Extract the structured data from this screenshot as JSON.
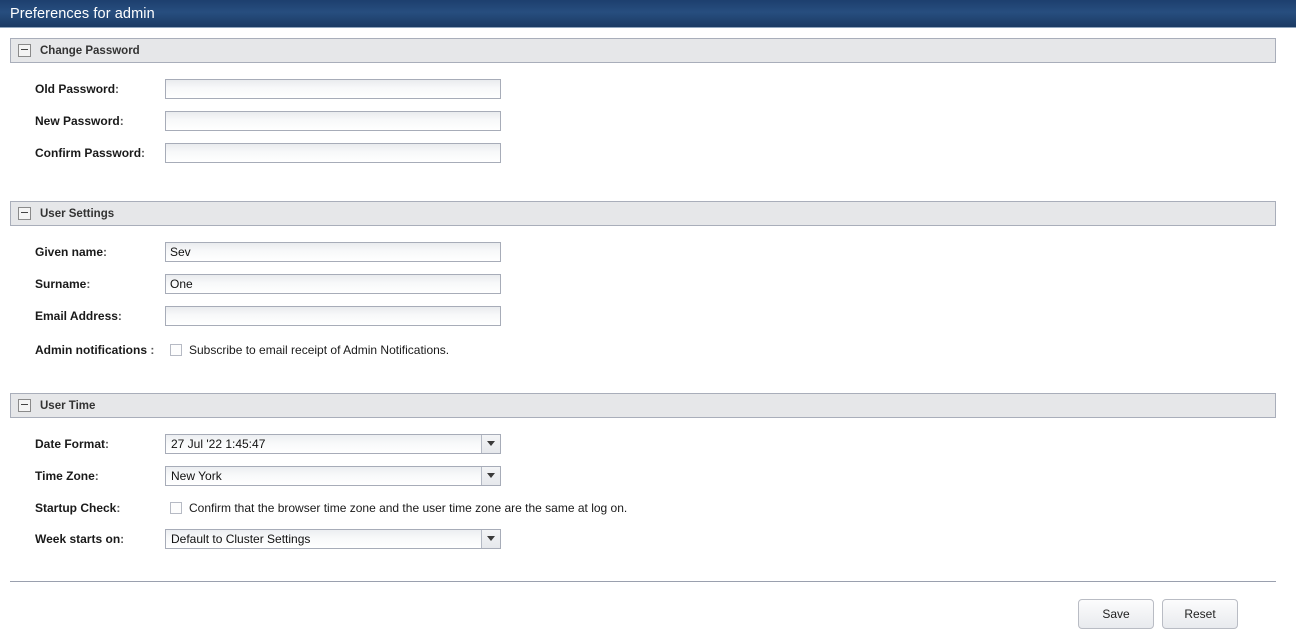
{
  "titlebar": {
    "title": "Preferences for admin"
  },
  "sections": [
    {
      "id": "change-password",
      "title": "Change Password",
      "collapse_icon": "minus-box-icon"
    },
    {
      "id": "user-settings",
      "title": "User Settings",
      "collapse_icon": "minus-box-icon"
    },
    {
      "id": "user-time",
      "title": "User Time",
      "collapse_icon": "minus-box-icon"
    }
  ],
  "change_password": {
    "old_password": {
      "label": "Old Password",
      "colon": ":",
      "value": ""
    },
    "new_password": {
      "label": "New Password",
      "colon": ":",
      "value": ""
    },
    "confirm_password": {
      "label": "Confirm Password",
      "colon": ":",
      "value": ""
    }
  },
  "user_settings": {
    "given_name": {
      "label": "Given name",
      "colon": ":",
      "value": "Sev"
    },
    "surname": {
      "label": "Surname",
      "colon": ":",
      "value": "One"
    },
    "email_address": {
      "label": "Email Address",
      "colon": ":",
      "value": ""
    },
    "admin_notifications": {
      "label": "Admin notifications ",
      "colon": ":",
      "checkbox_label": "Subscribe to email receipt of Admin Notifications.",
      "checked": false
    }
  },
  "user_time": {
    "date_format": {
      "label": "Date Format",
      "colon": ":",
      "value": "27 Jul '22 1:45:47",
      "arrow_icon": "chevron-down-icon"
    },
    "time_zone": {
      "label": "Time Zone",
      "colon": ":",
      "value": "New York",
      "arrow_icon": "chevron-down-icon"
    },
    "startup_check": {
      "label": "Startup Check",
      "colon": ":",
      "checkbox_label": "Confirm that the browser time zone and the user time zone are the same at log on.",
      "checked": false
    },
    "week_starts_on": {
      "label": "Week starts on",
      "colon": ":",
      "value": "Default to Cluster Settings",
      "arrow_icon": "chevron-down-icon"
    }
  },
  "footer": {
    "save_label": "Save",
    "reset_label": "Reset"
  },
  "colors": {
    "titlebar_navy": "#274e7f",
    "section_header_gray": "#e6e7e9",
    "border_gray": "#a9aeba"
  }
}
